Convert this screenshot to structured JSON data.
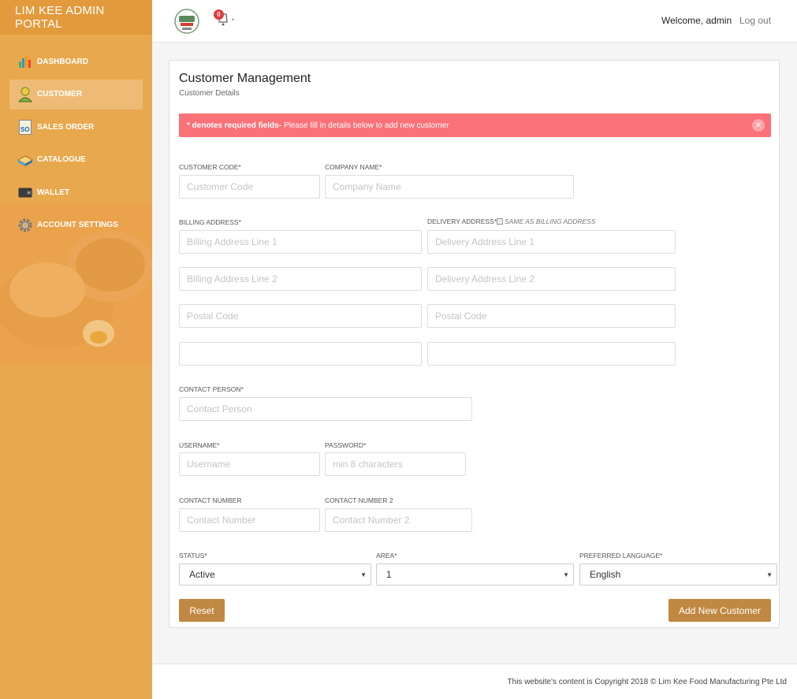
{
  "app": {
    "brand": "LIM KEE ADMIN PORTAL"
  },
  "colors": {
    "sidebar": "#e8a84e",
    "accent_button": "#c08842",
    "alert": "#fb7178"
  },
  "sidebar": {
    "items": [
      {
        "label": "DASHBOARD",
        "icon": "bar-chart-icon"
      },
      {
        "label": "CUSTOMER",
        "icon": "user-icon",
        "active": true
      },
      {
        "label": "SALES ORDER",
        "icon": "so-document-icon"
      },
      {
        "label": "CATALOGUE",
        "icon": "catalogue-icon"
      },
      {
        "label": "WALLET",
        "icon": "wallet-icon"
      },
      {
        "label": "ACCOUNT SETTINGS",
        "icon": "gear-icon"
      }
    ]
  },
  "topbar": {
    "notification_count": "0",
    "welcome": "Welcome, admin",
    "logout": "Log out"
  },
  "page": {
    "title": "Customer Management",
    "subtitle": "Customer Details"
  },
  "alert": {
    "bold": "* denotes required fields-",
    "text": "Please fill in details below to add new customer"
  },
  "form": {
    "customer_code": {
      "label": "CUSTOMER CODE*",
      "placeholder": "Customer Code"
    },
    "company_name": {
      "label": "COMPANY NAME*",
      "placeholder": "Company Name"
    },
    "billing": {
      "label": "BILLING ADDRESS*",
      "line1": "Billing Address Line 1",
      "line2": "Billing Address Line 2",
      "postal": "Postal Code"
    },
    "delivery": {
      "label": "DELIVERY ADDRESS*",
      "same_as": "SAME AS BILLING ADDRESS",
      "line1": "Delivery Address Line 1",
      "line2": "Delivery Address Line 2",
      "postal": "Postal Code"
    },
    "contact_person": {
      "label": "CONTACT PERSON*",
      "placeholder": "Contact Person"
    },
    "username": {
      "label": "USERNAME*",
      "placeholder": "Username"
    },
    "password": {
      "label": "PASSWORD*",
      "placeholder": "min 8 characters"
    },
    "contact_number": {
      "label": "CONTACT NUMBER",
      "placeholder": "Contact Number"
    },
    "contact_number_2": {
      "label": "CONTACT NUMBER 2",
      "placeholder": "Contact Number 2"
    },
    "status": {
      "label": "STATUS*",
      "value": "Active"
    },
    "area": {
      "label": "AREA*",
      "value": "1"
    },
    "language": {
      "label": "PREFERRED LANGUAGE*",
      "value": "English"
    },
    "reset": "Reset",
    "submit": "Add New Customer"
  },
  "footer": {
    "text": "This website's content is Copyright 2018 © Lim Kee Food Manufacturing Pte Ltd"
  }
}
